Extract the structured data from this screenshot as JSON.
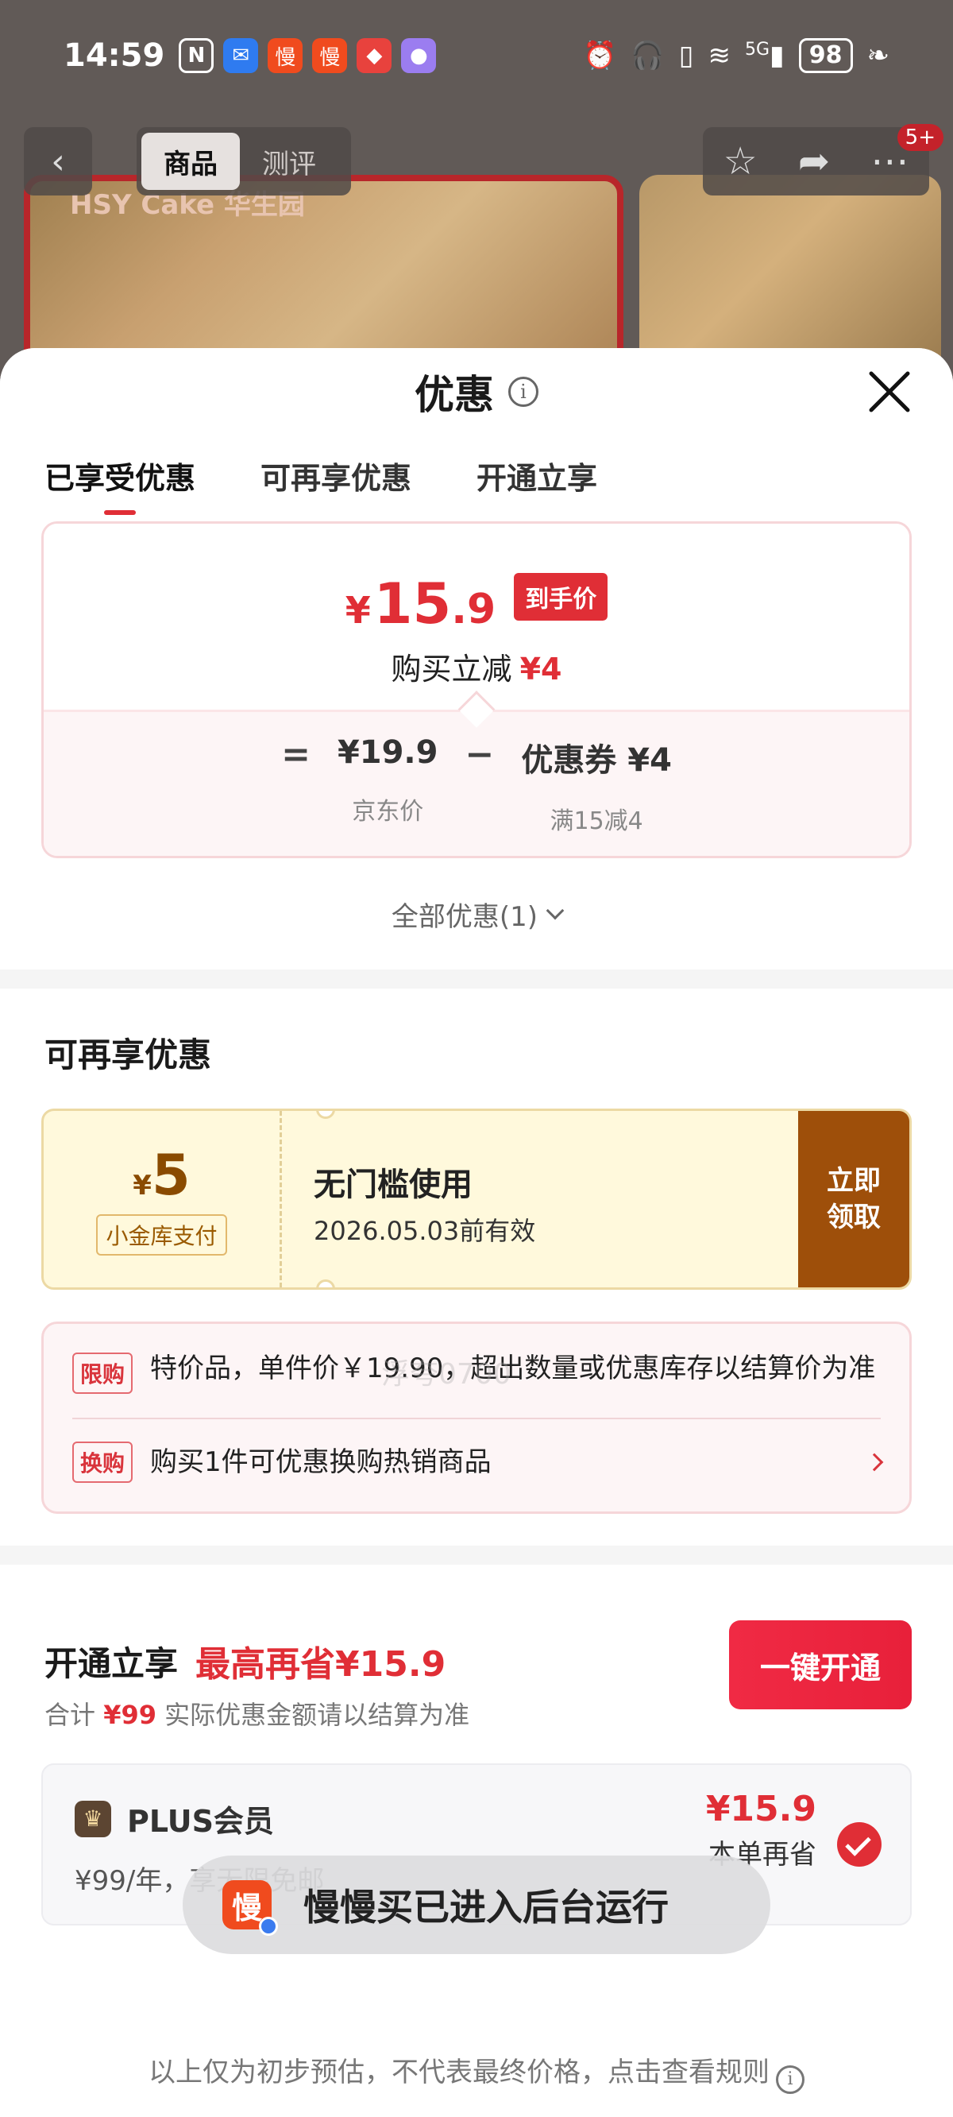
{
  "status_bar": {
    "time": "14:59",
    "battery": "98",
    "network": "5G"
  },
  "background_page": {
    "tabs": [
      "商品",
      "测评"
    ],
    "brand": "HSY Cake 华生园",
    "cart_badge": "5+"
  },
  "sheet": {
    "title": "优惠",
    "tabs": [
      "已享受优惠",
      "可再享优惠",
      "开通立享"
    ],
    "active_tab": 0
  },
  "price_card": {
    "currency": "¥",
    "final_int": "15",
    "final_dec": ".9",
    "final_tag": "到手价",
    "reduce_label": "购买立减",
    "reduce_amount": "¥4",
    "jd_price": "¥19.9",
    "jd_price_label": "京东价",
    "coupon_value": "优惠券 ¥4",
    "coupon_label": "满15减4",
    "eq": "=",
    "minus": "−"
  },
  "all_promos": "全部优惠(1)",
  "watermark": "浮夸0700",
  "more_promos": {
    "title": "可再享优惠",
    "coupon": {
      "currency": "¥",
      "amount": "5",
      "chip": "小金库支付",
      "desc": "无门槛使用",
      "valid": "2026.05.03前有效",
      "button": "立即领取"
    },
    "limit_tag": "限购",
    "limit_text": "特价品，单件价￥19.90，超出数量或优惠库存以结算价为准",
    "swap_tag": "换购",
    "swap_text": "购买1件可优惠换购热销商品"
  },
  "open_now": {
    "title": "开通立享",
    "max_save": "最高再省¥15.9",
    "button": "一键开通",
    "sub_prefix": "合计",
    "sub_amount": "¥99",
    "sub_suffix": "实际优惠金额请以结算为准",
    "plus_name": "PLUS会员",
    "plus_desc": "¥99/年，享无限免邮",
    "plus_save": "¥15.9",
    "plus_save_label": "本单再省"
  },
  "toast": {
    "icon_char": "慢",
    "text": "慢慢买已进入后台运行"
  },
  "disclaimer": "以上仅为初步预估，不代表最终价格，点击查看规则"
}
